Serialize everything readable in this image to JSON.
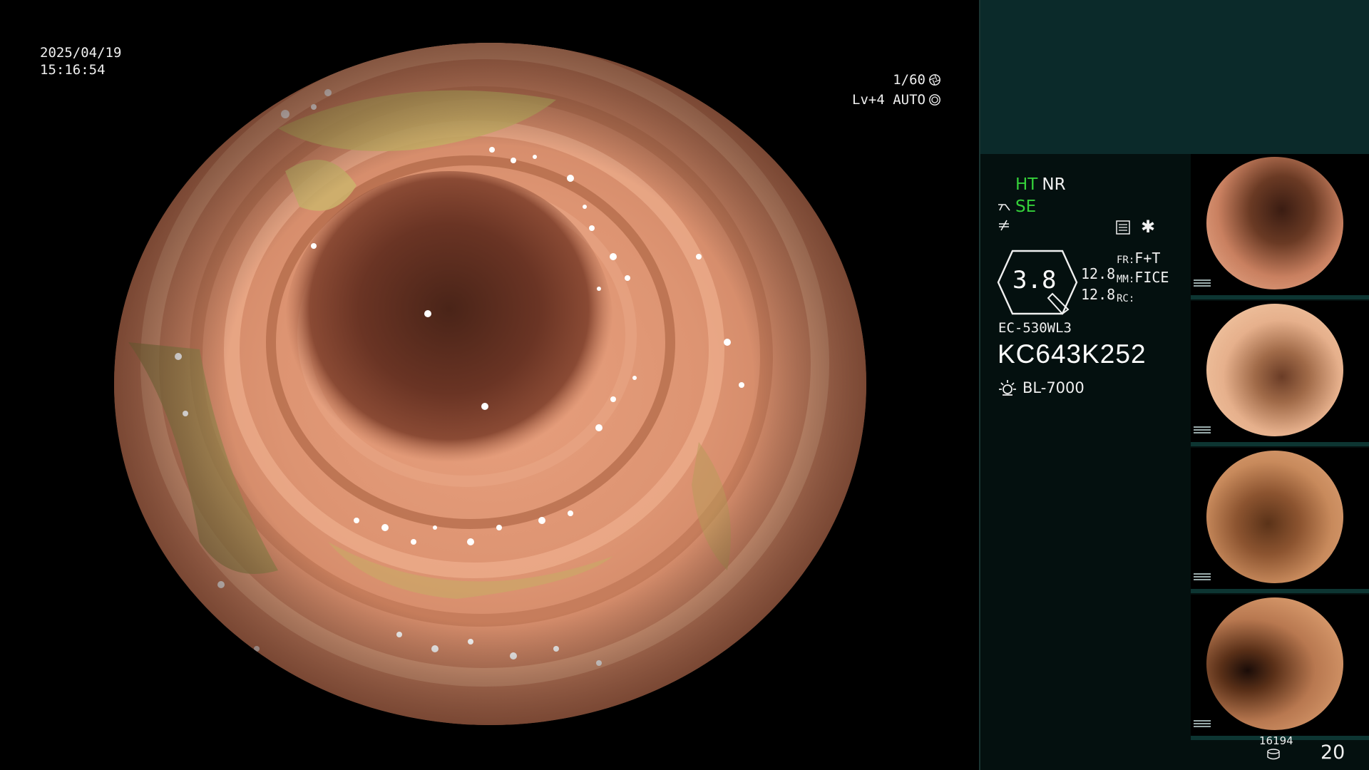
{
  "timestamp": {
    "date": "2025/04/19",
    "time": "15:16:54"
  },
  "exposure": {
    "shutter": "1/60",
    "level": "Lv+4 AUTO"
  },
  "modes": {
    "ht": "HT",
    "nr": "NR",
    "se": "SE"
  },
  "gauge": {
    "value": "3.8"
  },
  "readings": {
    "a": "12.8",
    "b": "12.8"
  },
  "flags": {
    "fr_key": "FR:",
    "fr_val": "F+T",
    "mm_key": "MM:",
    "mm_val": "FICE",
    "rc_key": "RC:",
    "rc_val": ""
  },
  "scope": {
    "model": "EC-530WL3",
    "serial": "KC643K252"
  },
  "light_source": {
    "name": "BL-7000"
  },
  "counters": {
    "small": "16194",
    "big": "20"
  },
  "thumbnails": [
    {
      "name": "thumbnail-1"
    },
    {
      "name": "thumbnail-2"
    },
    {
      "name": "thumbnail-3"
    },
    {
      "name": "thumbnail-4"
    }
  ],
  "colors": {
    "accent_green": "#35d13a",
    "panel_teal": "#0b2a2a",
    "panel_dark": "#04100f"
  }
}
